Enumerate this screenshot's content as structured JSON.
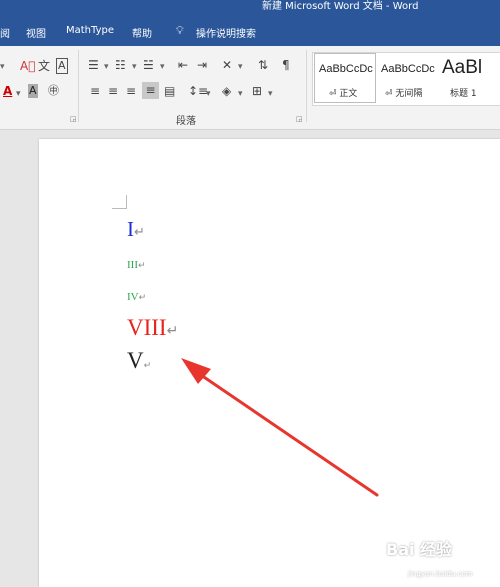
{
  "window": {
    "title": "新建 Microsoft Word 文档  -  Word"
  },
  "tabs": [
    "阅",
    "视图",
    "MathType",
    "帮助"
  ],
  "tell_me": {
    "label": "操作说明搜索",
    "icon": "lightbulb-icon"
  },
  "ribbon": {
    "paragraph_group_label": "段落",
    "styles": [
      {
        "sample": "AaBbCcDc",
        "name": "⏎ 正文"
      },
      {
        "sample": "AaBbCcDc",
        "name": "⏎ 无间隔"
      },
      {
        "sample": "AaBl",
        "name": "标题 1"
      }
    ]
  },
  "document": {
    "lines": [
      {
        "text": "I",
        "color": "#1a2fd6",
        "mark": "↵"
      },
      {
        "text": "III",
        "color": "#2aa84a",
        "mark": "↵"
      },
      {
        "text": "IV",
        "color": "#2aa84a",
        "mark": "↵"
      },
      {
        "text": "VIII",
        "color": "#e8221d",
        "mark": "↵"
      },
      {
        "text": "V",
        "color": "#222222",
        "mark": "↵"
      }
    ]
  },
  "annotation": {
    "arrow_color": "#e8352d"
  },
  "watermark": {
    "text": "Bai 经验",
    "sub": "jingyan.baidu.com"
  }
}
